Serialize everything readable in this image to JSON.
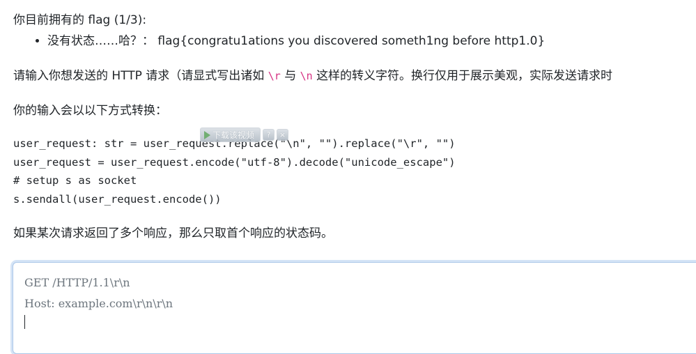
{
  "flags": {
    "heading": "你目前拥有的 flag (1/3):",
    "items": [
      "没有状态……哈？： flag{congratu1ations you discovered someth1ng before http1.0}"
    ]
  },
  "instructions": {
    "prefix": "请输入你想发送的 HTTP 请求（请显式写出诸如",
    "cr_code": "\\r",
    "and": "与",
    "lf_code": "\\n",
    "suffix": "这样的转义字符。换行仅用于展示美观，实际发送请求时"
  },
  "transform_intro": "你的输入会以以下方式转换：",
  "code_lines": [
    "user_request: str = user_request.replace(\"\\n\", \"\").replace(\"\\r\", \"\")",
    "user_request = user_request.encode(\"utf-8\").decode(\"unicode_escape\")",
    "# setup s as socket",
    "s.sendall(user_request.encode())"
  ],
  "video_overlay": {
    "download_label": "下载该视频",
    "help_label": "?",
    "close_label": "×"
  },
  "note": "如果某次请求返回了多个响应，那么只取首个响应的状态码。",
  "request_input": {
    "lines": [
      "GET /HTTP/1.1\\r\\n",
      "Host: example.com\\r\\n\\r\\n"
    ]
  }
}
